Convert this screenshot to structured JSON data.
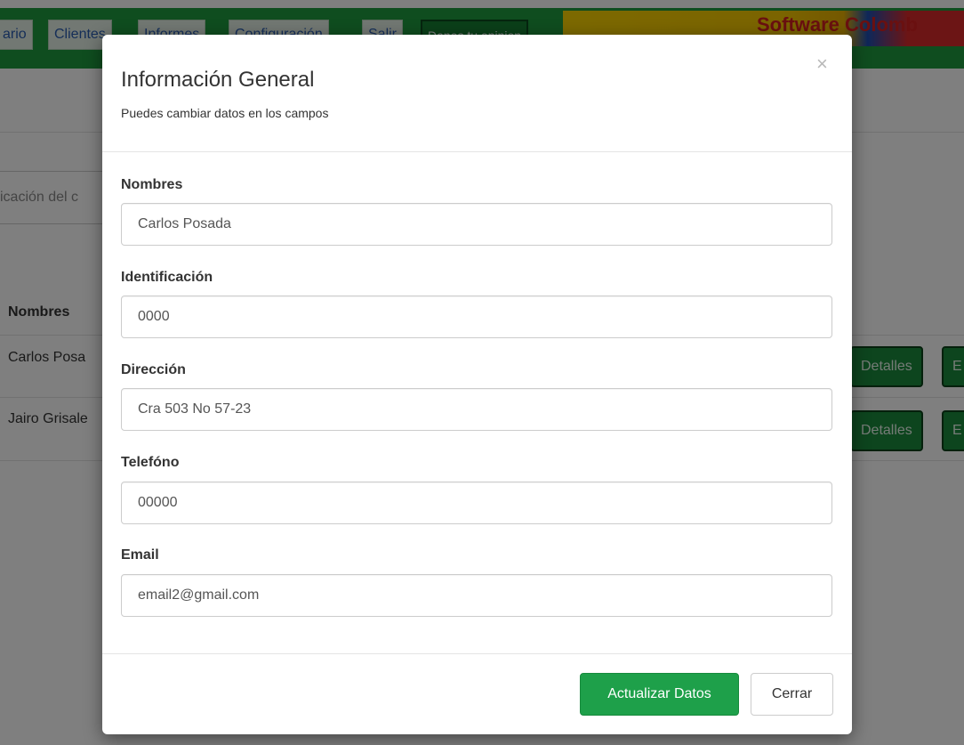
{
  "nav": {
    "items": [
      "ario",
      "Clientes",
      "Informes",
      "Configuración",
      "Salir"
    ],
    "opinion_label": "Danos tu opinion",
    "banner_text": "Software Colomb"
  },
  "background": {
    "search_placeholder": "icación del c",
    "table_header_name": "Nombres",
    "rows": [
      {
        "name": "Carlos Posa",
        "details_label": "Detalles",
        "extra_label": "E"
      },
      {
        "name": "Jairo Grisale",
        "details_label": "Detalles",
        "extra_label": "E"
      }
    ]
  },
  "modal": {
    "title": "Información General",
    "subtitle": "Puedes cambiar datos en los campos",
    "close_label": "×",
    "fields": [
      {
        "label": "Nombres",
        "value": "Carlos Posada"
      },
      {
        "label": "Identificación",
        "value": "0000"
      },
      {
        "label": "Dirección",
        "value": "Cra 503 No 57-23"
      },
      {
        "label": "Telefóno",
        "value": "00000"
      },
      {
        "label": "Email",
        "value": "email2@gmail.com"
      }
    ],
    "submit_label": "Actualizar Datos",
    "cancel_label": "Cerrar",
    "primary_color": "#1ea04a"
  }
}
